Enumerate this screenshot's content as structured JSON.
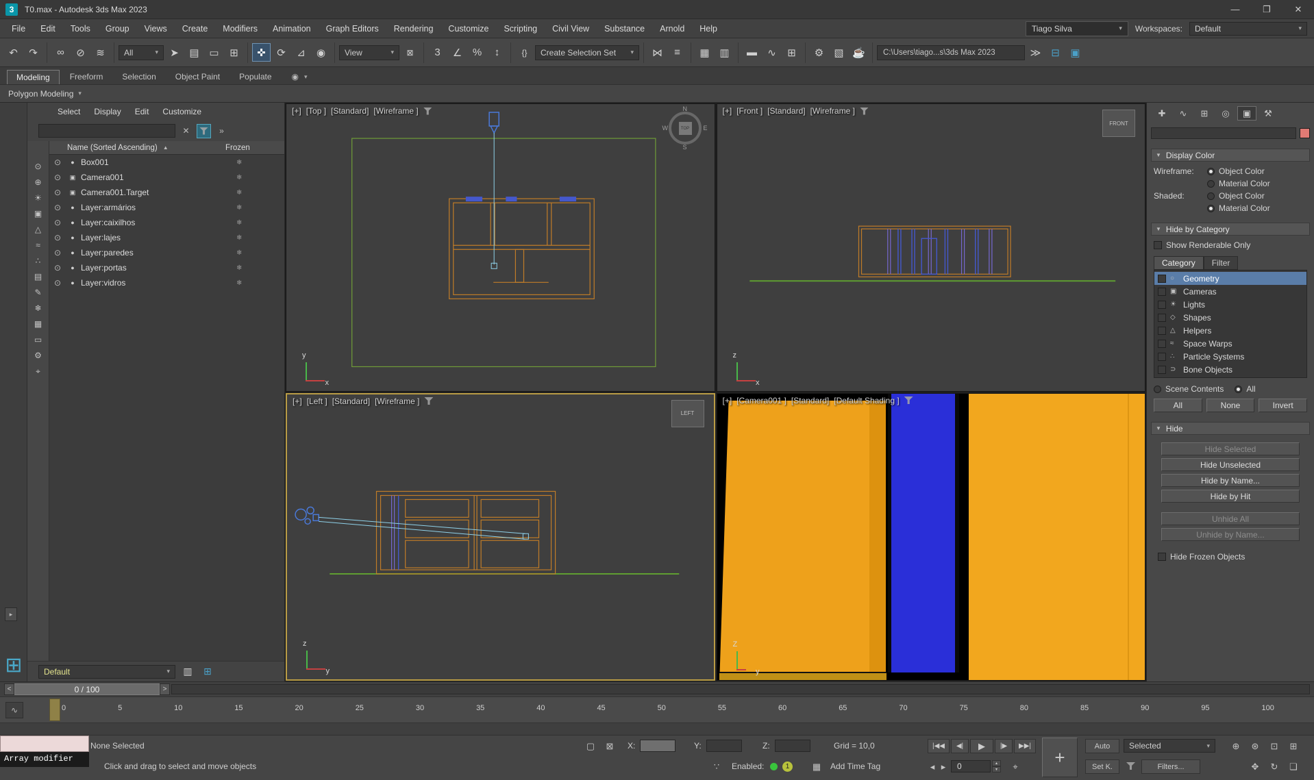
{
  "window": {
    "title": "T0.max - Autodesk 3ds Max 2023"
  },
  "menu_bar": {
    "items": [
      "File",
      "Edit",
      "Tools",
      "Group",
      "Views",
      "Create",
      "Modifiers",
      "Animation",
      "Graph Editors",
      "Rendering",
      "Customize",
      "Scripting",
      "Civil View",
      "Substance",
      "Arnold",
      "Help"
    ],
    "user": "Tiago Silva",
    "workspaces_label": "Workspaces:",
    "workspace": "Default"
  },
  "toolbar": {
    "filter_all": "All",
    "view": "View",
    "create_selection_set": "Create Selection Set",
    "project_path": "C:\\Users\\tiago...s\\3ds Max 2023"
  },
  "ribbon": {
    "tabs": [
      "Modeling",
      "Freeform",
      "Selection",
      "Object Paint",
      "Populate"
    ],
    "active_tab": "Modeling",
    "panel": "Polygon Modeling"
  },
  "scene_explorer": {
    "menus": [
      "Select",
      "Display",
      "Edit",
      "Customize"
    ],
    "columns": {
      "name": "Name (Sorted Ascending)",
      "frozen": "Frozen"
    },
    "rows": [
      {
        "name": "Box001",
        "type": "geometry"
      },
      {
        "name": "Camera001",
        "type": "camera"
      },
      {
        "name": "Camera001.Target",
        "type": "camera"
      },
      {
        "name": "Layer:armários",
        "type": "layer"
      },
      {
        "name": "Layer:caixilhos",
        "type": "layer"
      },
      {
        "name": "Layer:lajes",
        "type": "layer"
      },
      {
        "name": "Layer:paredes",
        "type": "layer"
      },
      {
        "name": "Layer:portas",
        "type": "layer"
      },
      {
        "name": "Layer:vidros",
        "type": "layer"
      }
    ],
    "strip_icons": [
      {
        "name": "display-objects-icon",
        "glyph": "⊙"
      },
      {
        "name": "display-children-icon",
        "glyph": "⊕"
      },
      {
        "name": "display-lights-icon",
        "glyph": "☀"
      },
      {
        "name": "display-cameras-icon",
        "glyph": "▣"
      },
      {
        "name": "display-helpers-icon",
        "glyph": "△"
      },
      {
        "name": "display-spacewarps-icon",
        "glyph": "≈"
      },
      {
        "name": "display-particles-icon",
        "glyph": "∴"
      },
      {
        "name": "display-layers-icon",
        "glyph": "▤"
      },
      {
        "name": "edit-name-icon",
        "glyph": "✎"
      },
      {
        "name": "frozen-filter-icon",
        "glyph": "❄"
      },
      {
        "name": "display-materials-icon",
        "glyph": "▦"
      },
      {
        "name": "display-shapes-icon",
        "glyph": "▭"
      },
      {
        "name": "settings-icon",
        "glyph": "⚙"
      },
      {
        "name": "pick-parent-icon",
        "glyph": "⌖"
      }
    ],
    "selection_preset": "Default"
  },
  "viewports": [
    {
      "plus": "[+]",
      "view": "[Top ]",
      "renderer": "[Standard]",
      "shading": "[Wireframe ]",
      "compass": {
        "n": "N",
        "w": "W",
        "e": "E",
        "s": "S",
        "face": "TOP"
      },
      "axis": {
        "v": "y",
        "h": "x"
      }
    },
    {
      "plus": "[+]",
      "view": "[Front ]",
      "renderer": "[Standard]",
      "shading": "[Wireframe ]",
      "cube": "FRONT",
      "axis": {
        "v": "z",
        "h": "x"
      }
    },
    {
      "plus": "[+]",
      "view": "[Left ]",
      "renderer": "[Standard]",
      "shading": "[Wireframe ]",
      "cube": "LEFT",
      "axis": {
        "v": "z",
        "h": "y"
      }
    },
    {
      "plus": "[+]",
      "view": "[Camera001 ]",
      "renderer": "[Standard]",
      "shading": "[Default Shading ]",
      "axis": {
        "v": "Z",
        "h": "y"
      }
    }
  ],
  "command_panel": {
    "display_color": {
      "title": "Display Color",
      "wireframe_label": "Wireframe:",
      "shaded_label": "Shaded:",
      "object_color": "Object Color",
      "material_color": "Material Color"
    },
    "hide_by_category": {
      "title": "Hide by Category",
      "show_renderable": "Show Renderable Only",
      "tabs": [
        "Category",
        "Filter"
      ],
      "active_tab": "Category",
      "categories": [
        {
          "label": "Geometry",
          "icon": "sphere-icon",
          "glyph": "○",
          "selected": true
        },
        {
          "label": "Cameras",
          "icon": "camera-icon",
          "glyph": "▣"
        },
        {
          "label": "Lights",
          "icon": "light-icon",
          "glyph": "☀"
        },
        {
          "label": "Shapes",
          "icon": "shape-icon",
          "glyph": "◇"
        },
        {
          "label": "Helpers",
          "icon": "helper-icon",
          "glyph": "△"
        },
        {
          "label": "Space Warps",
          "icon": "space-warp-icon",
          "glyph": "≈"
        },
        {
          "label": "Particle Systems",
          "icon": "particles-icon",
          "glyph": "∴"
        },
        {
          "label": "Bone Objects",
          "icon": "bone-icon",
          "glyph": "⊃"
        }
      ],
      "scene_contents": "Scene Contents",
      "all_label": "All",
      "buttons": [
        "All",
        "None",
        "Invert"
      ]
    },
    "hide": {
      "title": "Hide",
      "buttons": [
        {
          "label": "Hide Selected",
          "disabled": true
        },
        {
          "label": "Hide Unselected"
        },
        {
          "label": "Hide by Name..."
        },
        {
          "label": "Hide by Hit"
        },
        {
          "label": "Unhide All",
          "disabled": true,
          "gap": true
        },
        {
          "label": "Unhide by Name...",
          "disabled": true
        }
      ],
      "hide_frozen": "Hide Frozen Objects"
    }
  },
  "timeline": {
    "slider": "0 / 100",
    "ticks": [
      "0",
      "5",
      "10",
      "15",
      "20",
      "25",
      "30",
      "35",
      "40",
      "45",
      "50",
      "55",
      "60",
      "65",
      "70",
      "75",
      "80",
      "85",
      "90",
      "95",
      "100"
    ]
  },
  "status_bar": {
    "listener_output": "Array modifier",
    "selection_status": "None Selected",
    "prompt": "Click and drag to select and move objects",
    "coord_x": "X:",
    "coord_y": "Y:",
    "coord_z": "Z:",
    "grid": "Grid = 10,0",
    "enabled_label": "Enabled:",
    "enabled_count": "1",
    "add_time_tag": "Add Time Tag",
    "frame": "0",
    "auto": "Auto",
    "selected": "Selected",
    "set_key": "Set K.",
    "filters": "Filters..."
  },
  "icons": {
    "app_logo": "3",
    "minimize": "—",
    "maximize": "❐",
    "close": "✕",
    "caret": "▾",
    "undo": "↶",
    "redo": "↷",
    "link": "∞",
    "unlink": "⊘",
    "bind": "≋",
    "select": "➤",
    "select_by_name": "▤",
    "region": "▭",
    "crossing": "⊞",
    "move": "✜",
    "rotate": "⟳",
    "scale": "⊿",
    "placement": "◉",
    "lock": "⊠",
    "snap3": "3",
    "snap_angle": "∠",
    "snap_percent": "%",
    "snap_spinner": "↕",
    "named_sets": "{}",
    "mirror": "⋈",
    "align": "≡",
    "layer_explorer": "▥",
    "scene_explorer_t": "▦",
    "ribbon": "▬",
    "curve_editor": "∿",
    "schematic": "⊞",
    "render_setup": "⚙",
    "rendered_frame": "▧",
    "render": "☕",
    "more": "≫",
    "layouts": "⊟",
    "isolate2": "▣",
    "clear": "✕",
    "more2": "»",
    "eye": "⊙",
    "camera_obj": "▣",
    "object_dot": "●",
    "frozen": "❄",
    "sort_asc": "▲",
    "go_start": "|◀◀",
    "prev_frame": "◀|",
    "play": "▶",
    "next_frame": "|▶",
    "go_end": "▶▶|",
    "key_big": "+",
    "isolate": "▢",
    "lock_sel": "⊠",
    "abs_offset": "⌖",
    "zoom": "⊕",
    "zoom_all": "⊛",
    "zoom_ext": "⊡",
    "zoom_reg": "⊞",
    "pan": "✥",
    "orbit": "↻",
    "maximize_vp": "❏",
    "paw": "∵",
    "time_tag": "▦",
    "spin_up": "▴",
    "spin_dn": "▾",
    "frame_prev": "◂",
    "frame_next": "▸",
    "slider_left": "<",
    "slider_right": ">",
    "gutter_arrow": "▸",
    "gutter_grid": "⊞",
    "ruler_icon": "∿",
    "cp_create": "✚",
    "cp_modify": "∿",
    "cp_hier": "⊞",
    "cp_motion": "◎",
    "cp_display": "▣",
    "cp_util": "⚒",
    "rollout_open": "▼"
  }
}
